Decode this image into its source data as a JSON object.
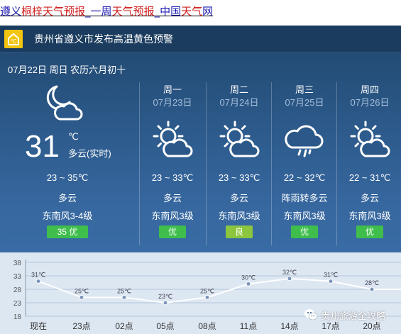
{
  "top_link": {
    "parts": [
      {
        "text": "遵义",
        "color": "blue"
      },
      {
        "text": "桐梓",
        "color": "red"
      },
      {
        "text": "天气预报",
        "color": "red"
      },
      {
        "text": "_一周",
        "color": "blue"
      },
      {
        "text": "天气预报",
        "color": "red"
      },
      {
        "text": "_中国",
        "color": "blue"
      },
      {
        "text": "天气",
        "color": "red"
      },
      {
        "text": "网",
        "color": "blue"
      }
    ]
  },
  "alert": {
    "text": "贵州省遵义市发布高温黄色预警",
    "icon": "heat-warning-icon",
    "color": "#f1c40f"
  },
  "today": {
    "date_line": "07月22日 周日 农历六月初十",
    "icon": "moon-cloud-icon",
    "temp": "31",
    "unit": "℃",
    "desc": "多云(实时)",
    "range": "23 ~ 35℃",
    "weather": "多云",
    "wind": "东南风3-4级",
    "aqi": "35  优"
  },
  "forecast": [
    {
      "day": "周一",
      "date": "07月23日",
      "icon": "sun-cloud-icon",
      "range": "23 ~ 33℃",
      "weather": "多云",
      "wind": "东南风3级",
      "aqi": "优",
      "aqi_color": "#3fbe4c"
    },
    {
      "day": "周二",
      "date": "07月24日",
      "icon": "sun-cloud-icon",
      "range": "23 ~ 33℃",
      "weather": "多云",
      "wind": "东南风3级",
      "aqi": "良",
      "aqi_color": "#8cc63e"
    },
    {
      "day": "周三",
      "date": "07月25日",
      "icon": "rain-cloud-icon",
      "range": "22 ~ 32℃",
      "weather": "阵雨转多云",
      "wind": "东南风3级",
      "aqi": "优",
      "aqi_color": "#3fbe4c"
    },
    {
      "day": "周四",
      "date": "07月26日",
      "icon": "sun-cloud-icon",
      "range": "22 ~ 31℃",
      "weather": "多云",
      "wind": "东南风3级",
      "aqi": "优",
      "aqi_color": "#3fbe4c"
    }
  ],
  "chart_data": {
    "type": "line",
    "x": [
      "现在",
      "23点",
      "02点",
      "05点",
      "08点",
      "11点",
      "14点",
      "17点",
      "20点"
    ],
    "values": [
      31,
      25,
      25,
      23,
      25,
      30,
      32,
      31,
      28
    ],
    "labels": [
      "31℃",
      "25℃",
      "25℃",
      "23℃",
      "25℃",
      "30℃",
      "32℃",
      "31℃",
      "28℃"
    ],
    "y_ticks": [
      "38",
      "33",
      "28",
      "23",
      "18"
    ],
    "ylim": [
      18,
      38
    ],
    "grid": true,
    "line_color": "#ffffff"
  },
  "watermark": {
    "text": "贵州旅游全攻略",
    "icon": "wechat-icon"
  }
}
